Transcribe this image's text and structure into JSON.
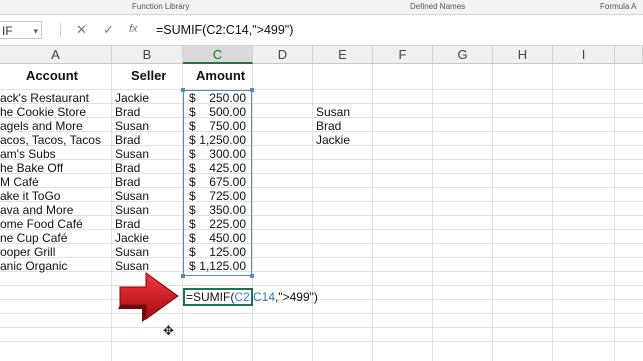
{
  "ribbon": {
    "groups": [
      "Function Library",
      "Defined Names",
      "Formula A"
    ]
  },
  "formula_bar": {
    "name_box": "IF",
    "cancel_icon": "close-icon",
    "enter_icon": "check-icon",
    "fx_label": "fx",
    "formula": "=SUMIF(C2:C14,\">499\")"
  },
  "columns": [
    "A",
    "B",
    "C",
    "D",
    "E",
    "F",
    "G",
    "H",
    "I"
  ],
  "headers": {
    "account": "Account",
    "seller": "Seller",
    "amount": "Amount"
  },
  "rows": [
    {
      "account": "ack's Restaurant",
      "seller": "Jackie",
      "cur": "$",
      "amount": "250.00"
    },
    {
      "account": "he Cookie Store",
      "seller": "Brad",
      "cur": "$",
      "amount": "500.00"
    },
    {
      "account": "agels and More",
      "seller": "Susan",
      "cur": "$",
      "amount": "750.00"
    },
    {
      "account": "acos, Tacos, Tacos",
      "seller": "Brad",
      "cur": "$",
      "amount": "1,250.00"
    },
    {
      "account": "am's Subs",
      "seller": "Susan",
      "cur": "$",
      "amount": "300.00"
    },
    {
      "account": "he Bake Off",
      "seller": "Brad",
      "cur": "$",
      "amount": "425.00"
    },
    {
      "account": "M Café",
      "seller": "Brad",
      "cur": "$",
      "amount": "675.00"
    },
    {
      "account": "ake it ToGo",
      "seller": "Susan",
      "cur": "$",
      "amount": "725.00"
    },
    {
      "account": "ava and More",
      "seller": "Susan",
      "cur": "$",
      "amount": "350.00"
    },
    {
      "account": "ome Food Café",
      "seller": "Brad",
      "cur": "$",
      "amount": "225.00"
    },
    {
      "account": "ne Cup Café",
      "seller": "Jackie",
      "cur": "$",
      "amount": "450.00"
    },
    {
      "account": "ooper Grill",
      "seller": "Susan",
      "cur": "$",
      "amount": "125.00"
    },
    {
      "account": "anic Organic",
      "seller": "Susan",
      "cur": "$",
      "amount": "1,125.00"
    }
  ],
  "sellers_list": [
    "Susan",
    "Brad",
    "Jackie"
  ],
  "edit_cell": {
    "prefix": "=SUMIF(",
    "ref": "C2:C14",
    "suffix": ",\">499\")"
  },
  "colors": {
    "accent": "#217346",
    "range": "#5b87c5",
    "arrow": "#d0171c"
  }
}
